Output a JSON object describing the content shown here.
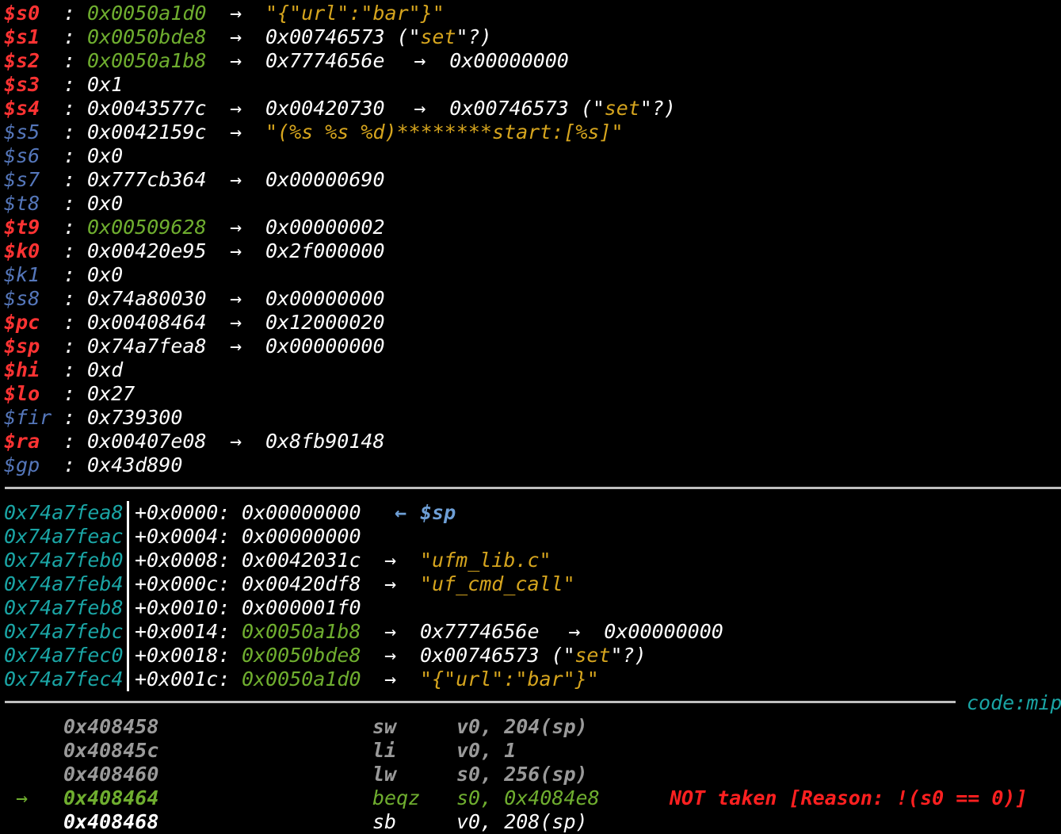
{
  "registers": [
    {
      "name": "$s0",
      "name_color": "red",
      "sep": ":",
      "value": "0x0050a1d0",
      "value_color": "green",
      "chain": [
        {
          "t": "→",
          "c": "white"
        },
        {
          "t": "\"{\"url\":\"bar\"}\"",
          "c": "yellow"
        }
      ]
    },
    {
      "name": "$s1",
      "name_color": "red",
      "sep": ":",
      "value": "0x0050bde8",
      "value_color": "green",
      "chain": [
        {
          "t": "→",
          "c": "white"
        },
        {
          "t": "0x00746573 (\"",
          "c": "white"
        },
        {
          "t": "set",
          "c": "yellow"
        },
        {
          "t": "\"?)",
          "c": "white"
        }
      ]
    },
    {
      "name": "$s2",
      "name_color": "red",
      "sep": ":",
      "value": "0x0050a1b8",
      "value_color": "green",
      "chain": [
        {
          "t": "→",
          "c": "white"
        },
        {
          "t": "0x7774656e",
          "c": "white"
        },
        {
          "t": "→",
          "c": "white"
        },
        {
          "t": "0x00000000",
          "c": "white"
        }
      ]
    },
    {
      "name": "$s3",
      "name_color": "red",
      "sep": ":",
      "value": "0x1",
      "value_color": "white",
      "chain": []
    },
    {
      "name": "$s4",
      "name_color": "red",
      "sep": ":",
      "value": "0x0043577c",
      "value_color": "white",
      "chain": [
        {
          "t": "→",
          "c": "white"
        },
        {
          "t": "0x00420730",
          "c": "white"
        },
        {
          "t": "→",
          "c": "white"
        },
        {
          "t": "0x00746573 (\"",
          "c": "white"
        },
        {
          "t": "set",
          "c": "yellow"
        },
        {
          "t": "\"?)",
          "c": "white"
        }
      ]
    },
    {
      "name": "$s5",
      "name_color": "blue",
      "sep": ":",
      "value": "0x0042159c",
      "value_color": "white",
      "chain": [
        {
          "t": "→",
          "c": "white"
        },
        {
          "t": "\"(%s %s %d)********start:[%s]\"",
          "c": "yellow"
        }
      ]
    },
    {
      "name": "$s6",
      "name_color": "blue",
      "sep": ":",
      "value": "0x0",
      "value_color": "white",
      "chain": []
    },
    {
      "name": "$s7",
      "name_color": "blue",
      "sep": ":",
      "value": "0x777cb364",
      "value_color": "white",
      "chain": [
        {
          "t": "→",
          "c": "white"
        },
        {
          "t": "0x00000690",
          "c": "white"
        }
      ]
    },
    {
      "name": "$t8",
      "name_color": "blue",
      "sep": ":",
      "value": "0x0",
      "value_color": "white",
      "chain": []
    },
    {
      "name": "$t9",
      "name_color": "red",
      "sep": ":",
      "value": "0x00509628",
      "value_color": "green",
      "chain": [
        {
          "t": "→",
          "c": "white"
        },
        {
          "t": "0x00000002",
          "c": "white"
        }
      ]
    },
    {
      "name": "$k0",
      "name_color": "red",
      "sep": ":",
      "value": "0x00420e95",
      "value_color": "white",
      "chain": [
        {
          "t": "→",
          "c": "white"
        },
        {
          "t": "0x2f000000",
          "c": "white"
        }
      ]
    },
    {
      "name": "$k1",
      "name_color": "blue",
      "sep": ":",
      "value": "0x0",
      "value_color": "white",
      "chain": []
    },
    {
      "name": "$s8",
      "name_color": "blue",
      "sep": ":",
      "value": "0x74a80030",
      "value_color": "white",
      "chain": [
        {
          "t": "→",
          "c": "white"
        },
        {
          "t": "0x00000000",
          "c": "white"
        }
      ]
    },
    {
      "name": "$pc",
      "name_color": "red",
      "sep": ":",
      "value": "0x00408464",
      "value_color": "white",
      "chain": [
        {
          "t": "→",
          "c": "white"
        },
        {
          "t": "0x12000020",
          "c": "white"
        }
      ]
    },
    {
      "name": "$sp",
      "name_color": "red",
      "sep": ":",
      "value": "0x74a7fea8",
      "value_color": "white",
      "chain": [
        {
          "t": "→",
          "c": "white"
        },
        {
          "t": "0x00000000",
          "c": "white"
        }
      ]
    },
    {
      "name": "$hi",
      "name_color": "red",
      "sep": ":",
      "value": "0xd",
      "value_color": "white",
      "chain": []
    },
    {
      "name": "$lo",
      "name_color": "red",
      "sep": ":",
      "value": "0x27",
      "value_color": "white",
      "chain": []
    },
    {
      "name": "$fir",
      "name_color": "blue",
      "sep": ":",
      "value": "0x739300",
      "value_color": "white",
      "chain": []
    },
    {
      "name": "$ra",
      "name_color": "red",
      "sep": ":",
      "value": "0x00407e08",
      "value_color": "white",
      "chain": [
        {
          "t": "→",
          "c": "white"
        },
        {
          "t": "0x8fb90148",
          "c": "white"
        }
      ]
    },
    {
      "name": "$gp",
      "name_color": "blue",
      "sep": ":",
      "value": "0x43d890",
      "value_color": "white",
      "chain": []
    }
  ],
  "stack": [
    {
      "addr": "0x74a7fea8",
      "offset": "+0x0000:",
      "value": "0x00000000",
      "value_color": "white",
      "chain": [
        {
          "t": "← ",
          "c": "spref"
        },
        {
          "t": "$sp",
          "c": "spref"
        }
      ]
    },
    {
      "addr": "0x74a7feac",
      "offset": "+0x0004:",
      "value": "0x00000000",
      "value_color": "white",
      "chain": []
    },
    {
      "addr": "0x74a7feb0",
      "offset": "+0x0008:",
      "value": "0x0042031c",
      "value_color": "white",
      "chain": [
        {
          "t": "→",
          "c": "white"
        },
        {
          "t": "\"ufm_lib.c\"",
          "c": "yellow"
        }
      ]
    },
    {
      "addr": "0x74a7feb4",
      "offset": "+0x000c:",
      "value": "0x00420df8",
      "value_color": "white",
      "chain": [
        {
          "t": "→",
          "c": "white"
        },
        {
          "t": "\"uf_cmd_call\"",
          "c": "yellow"
        }
      ]
    },
    {
      "addr": "0x74a7feb8",
      "offset": "+0x0010:",
      "value": "0x000001f0",
      "value_color": "white",
      "chain": []
    },
    {
      "addr": "0x74a7febc",
      "offset": "+0x0014:",
      "value": "0x0050a1b8",
      "value_color": "green",
      "chain": [
        {
          "t": "→",
          "c": "white"
        },
        {
          "t": "0x7774656e",
          "c": "white"
        },
        {
          "t": "→",
          "c": "white"
        },
        {
          "t": "0x00000000",
          "c": "white"
        }
      ]
    },
    {
      "addr": "0x74a7fec0",
      "offset": "+0x0018:",
      "value": "0x0050bde8",
      "value_color": "green",
      "chain": [
        {
          "t": "→",
          "c": "white"
        },
        {
          "t": "0x00746573 (\"",
          "c": "white"
        },
        {
          "t": "set",
          "c": "yellow"
        },
        {
          "t": "\"?)",
          "c": "white"
        }
      ]
    },
    {
      "addr": "0x74a7fec4",
      "offset": "+0x001c:",
      "value": "0x0050a1d0",
      "value_color": "green",
      "chain": [
        {
          "t": "→",
          "c": "white"
        },
        {
          "t": "\"{\"url\":\"bar\"}\"",
          "c": "yellow"
        }
      ]
    }
  ],
  "code_header": "code:mips",
  "code": [
    {
      "marker": "",
      "addr": "0x408458",
      "mnemonic": "sw",
      "operands": "v0, 204(sp)",
      "note": "",
      "style": "dim"
    },
    {
      "marker": "",
      "addr": "0x40845c",
      "mnemonic": "li",
      "operands": "v0, 1",
      "note": "",
      "style": "dim"
    },
    {
      "marker": "",
      "addr": "0x408460",
      "mnemonic": "lw",
      "operands": "s0, 256(sp)",
      "note": "",
      "style": "dim"
    },
    {
      "marker": "→",
      "addr": "0x408464",
      "mnemonic": "beqz",
      "operands": "s0, 0x4084e8",
      "note": "NOT taken [Reason: !(s0 == 0)]",
      "style": "current"
    },
    {
      "marker": "",
      "addr": "0x408468",
      "mnemonic": "sb",
      "operands": "v0, 208(sp)",
      "note": "",
      "style": "normal"
    }
  ]
}
